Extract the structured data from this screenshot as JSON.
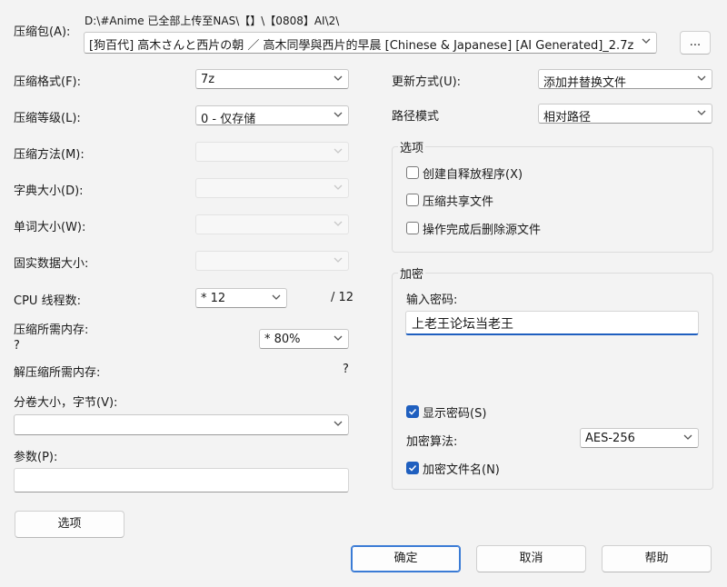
{
  "archive": {
    "label": "压缩包(A):",
    "path": "D:\\#Anime 已全部上传至NAS\\【】\\【0808】AI\\2\\",
    "filename": "[狗百代] 高木さんと西片の朝 ／ 高木同學與西片的早晨 [Chinese & Japanese] [AI Generated]_2.7z",
    "browse_label": "..."
  },
  "left": {
    "format_label": "压缩格式(F):",
    "format_value": "7z",
    "level_label": "压缩等级(L):",
    "level_value": "0 - 仅存储",
    "method_label": "压缩方法(M):",
    "dict_label": "字典大小(D):",
    "word_label": "单词大小(W):",
    "solid_label": "固实数据大小:",
    "threads_label": "CPU 线程数:",
    "threads_value": "* 12",
    "threads_max": "/ 12",
    "mem_label": "压缩所需内存:",
    "mem_q": "?",
    "mem_value": "* 80%",
    "decomp_label": "解压缩所需内存:",
    "decomp_q": "?",
    "volume_label": "分卷大小，字节(V):",
    "params_label": "参数(P):",
    "options_button": "选项"
  },
  "right": {
    "update_label": "更新方式(U):",
    "update_value": "添加并替换文件",
    "path_label": "路径模式",
    "path_value": "相对路径",
    "options_group": "选项",
    "opt_sfx": "创建自释放程序(X)",
    "opt_shared": "压缩共享文件",
    "opt_delete": "操作完成后删除源文件",
    "enc_group": "加密",
    "pwd_label": "输入密码:",
    "pwd_value": "上老王论坛当老王",
    "show_pwd": "显示密码(S)",
    "enc_method_label": "加密算法:",
    "enc_method_value": "AES-256",
    "enc_names": "加密文件名(N)"
  },
  "footer": {
    "ok": "确定",
    "cancel": "取消",
    "help": "帮助"
  },
  "colors": {
    "accent": "#1f5fbf",
    "bg": "#f3f3f3"
  }
}
